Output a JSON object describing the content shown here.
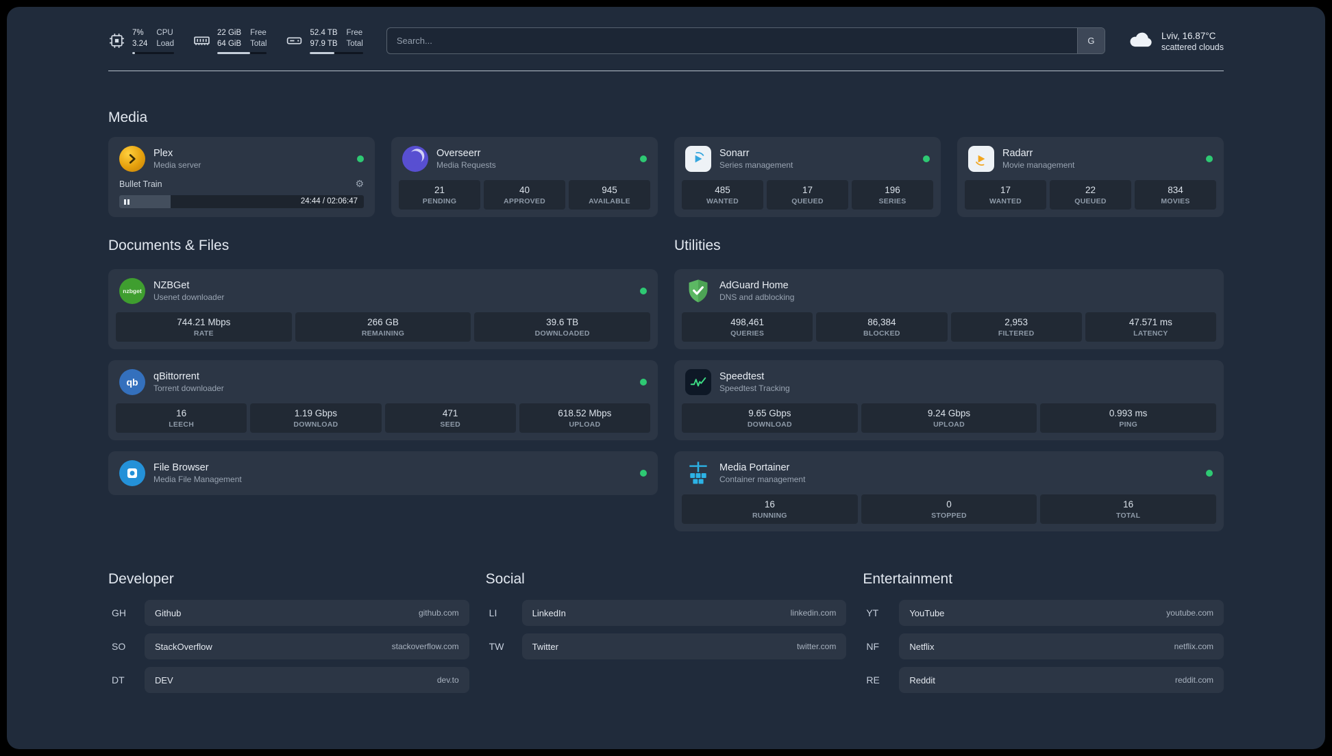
{
  "colors": {
    "status_online": "#2ec973",
    "accent_green": "#3ddc84"
  },
  "topbar": {
    "resources": [
      {
        "icon": "cpu-icon",
        "value_top": "7%",
        "value_bottom": "3.24",
        "label_top": "CPU",
        "label_bottom": "Load",
        "progress": 7
      },
      {
        "icon": "memory-icon",
        "value_top": "22 GiB",
        "value_bottom": "64 GiB",
        "label_top": "Free",
        "label_bottom": "Total",
        "progress": 66
      },
      {
        "icon": "disk-icon",
        "value_top": "52.4 TB",
        "value_bottom": "97.9 TB",
        "label_top": "Free",
        "label_bottom": "Total",
        "progress": 46
      }
    ],
    "search": {
      "placeholder": "Search...",
      "provider_button": "G"
    },
    "weather": {
      "location": "Lviv, 16.87°C",
      "condition": "scattered clouds"
    }
  },
  "media": {
    "title": "Media",
    "plex": {
      "name": "Plex",
      "desc": "Media server",
      "now_playing": "Bullet Train",
      "time": "24:44 / 02:06:47",
      "progress": 19
    },
    "services": [
      {
        "name": "Overseerr",
        "desc": "Media Requests",
        "stats": [
          {
            "value": "21",
            "label": "PENDING"
          },
          {
            "value": "40",
            "label": "APPROVED"
          },
          {
            "value": "945",
            "label": "AVAILABLE"
          }
        ]
      },
      {
        "name": "Sonarr",
        "desc": "Series management",
        "stats": [
          {
            "value": "485",
            "label": "WANTED"
          },
          {
            "value": "17",
            "label": "QUEUED"
          },
          {
            "value": "196",
            "label": "SERIES"
          }
        ]
      },
      {
        "name": "Radarr",
        "desc": "Movie management",
        "stats": [
          {
            "value": "17",
            "label": "WANTED"
          },
          {
            "value": "22",
            "label": "QUEUED"
          },
          {
            "value": "834",
            "label": "MOVIES"
          }
        ]
      }
    ]
  },
  "documents": {
    "title": "Documents & Files",
    "services": [
      {
        "name": "NZBGet",
        "desc": "Usenet downloader",
        "stats": [
          {
            "value": "744.21 Mbps",
            "label": "RATE"
          },
          {
            "value": "266 GB",
            "label": "REMAINING"
          },
          {
            "value": "39.6 TB",
            "label": "DOWNLOADED"
          }
        ]
      },
      {
        "name": "qBittorrent",
        "desc": "Torrent downloader",
        "stats": [
          {
            "value": "16",
            "label": "LEECH"
          },
          {
            "value": "1.19 Gbps",
            "label": "DOWNLOAD"
          },
          {
            "value": "471",
            "label": "SEED"
          },
          {
            "value": "618.52 Mbps",
            "label": "UPLOAD"
          }
        ]
      },
      {
        "name": "File Browser",
        "desc": "Media File Management",
        "stats": []
      }
    ]
  },
  "utilities": {
    "title": "Utilities",
    "services": [
      {
        "name": "AdGuard Home",
        "desc": "DNS and adblocking",
        "stats": [
          {
            "value": "498,461",
            "label": "QUERIES"
          },
          {
            "value": "86,384",
            "label": "BLOCKED"
          },
          {
            "value": "2,953",
            "label": "FILTERED"
          },
          {
            "value": "47.571 ms",
            "label": "LATENCY"
          }
        ]
      },
      {
        "name": "Speedtest",
        "desc": "Speedtest Tracking",
        "stats": [
          {
            "value": "9.65 Gbps",
            "label": "DOWNLOAD"
          },
          {
            "value": "9.24 Gbps",
            "label": "UPLOAD"
          },
          {
            "value": "0.993 ms",
            "label": "PING"
          }
        ]
      },
      {
        "name": "Media Portainer",
        "desc": "Container management",
        "stats": [
          {
            "value": "16",
            "label": "RUNNING"
          },
          {
            "value": "0",
            "label": "STOPPED"
          },
          {
            "value": "16",
            "label": "TOTAL"
          }
        ]
      }
    ]
  },
  "bookmarks": {
    "groups": [
      {
        "title": "Developer",
        "items": [
          {
            "abbr": "GH",
            "name": "Github",
            "domain": "github.com"
          },
          {
            "abbr": "SO",
            "name": "StackOverflow",
            "domain": "stackoverflow.com"
          },
          {
            "abbr": "DT",
            "name": "DEV",
            "domain": "dev.to"
          }
        ]
      },
      {
        "title": "Social",
        "items": [
          {
            "abbr": "LI",
            "name": "LinkedIn",
            "domain": "linkedin.com"
          },
          {
            "abbr": "TW",
            "name": "Twitter",
            "domain": "twitter.com"
          }
        ]
      },
      {
        "title": "Entertainment",
        "items": [
          {
            "abbr": "YT",
            "name": "YouTube",
            "domain": "youtube.com"
          },
          {
            "abbr": "NF",
            "name": "Netflix",
            "domain": "netflix.com"
          },
          {
            "abbr": "RE",
            "name": "Reddit",
            "domain": "reddit.com"
          }
        ]
      }
    ]
  }
}
